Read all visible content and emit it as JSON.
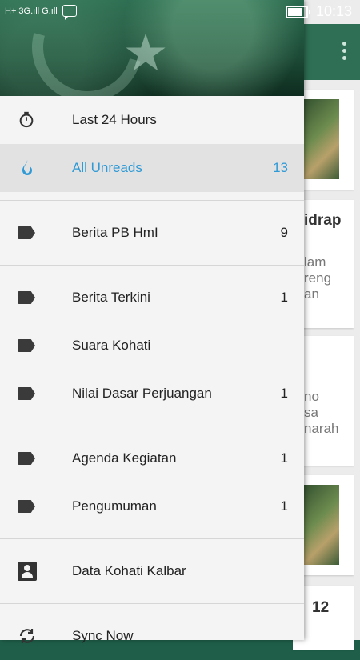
{
  "status_bar": {
    "left_text": "H+ 3G.ıll G.ıll",
    "time": "10:13",
    "battery_level": 0.9
  },
  "drawer": {
    "items": [
      {
        "label": "Last 24 Hours",
        "count": "",
        "icon": "stopwatch-icon"
      },
      {
        "label": "All Unreads",
        "count": "13",
        "icon": "flame-icon"
      },
      {
        "label": "Berita PB HmI",
        "count": "9",
        "icon": "tag-icon"
      },
      {
        "label": "Berita Terkini",
        "count": "1",
        "icon": "tag-icon"
      },
      {
        "label": "Suara Kohati",
        "count": "",
        "icon": "tag-icon"
      },
      {
        "label": "Nilai Dasar Perjuangan",
        "count": "1",
        "icon": "tag-icon"
      },
      {
        "label": "Agenda Kegiatan",
        "count": "1",
        "icon": "tag-icon"
      },
      {
        "label": "Pengumuman",
        "count": "1",
        "icon": "tag-icon"
      },
      {
        "label": "Data Kohati Kalbar",
        "count": "",
        "icon": "contact-icon"
      },
      {
        "label": "Sync Now",
        "count": "",
        "icon": "sync-icon"
      }
    ]
  },
  "background": {
    "card2_title": "idrap",
    "card2_lines": [
      "lam",
      "reng",
      "an"
    ],
    "card3_lines": [
      "no",
      "sa",
      "narah"
    ],
    "card5_title": "12"
  },
  "colors": {
    "accent": "#2f9ad6",
    "toolbar": "#2e6f55",
    "active_bg": "#e2e2e2"
  }
}
